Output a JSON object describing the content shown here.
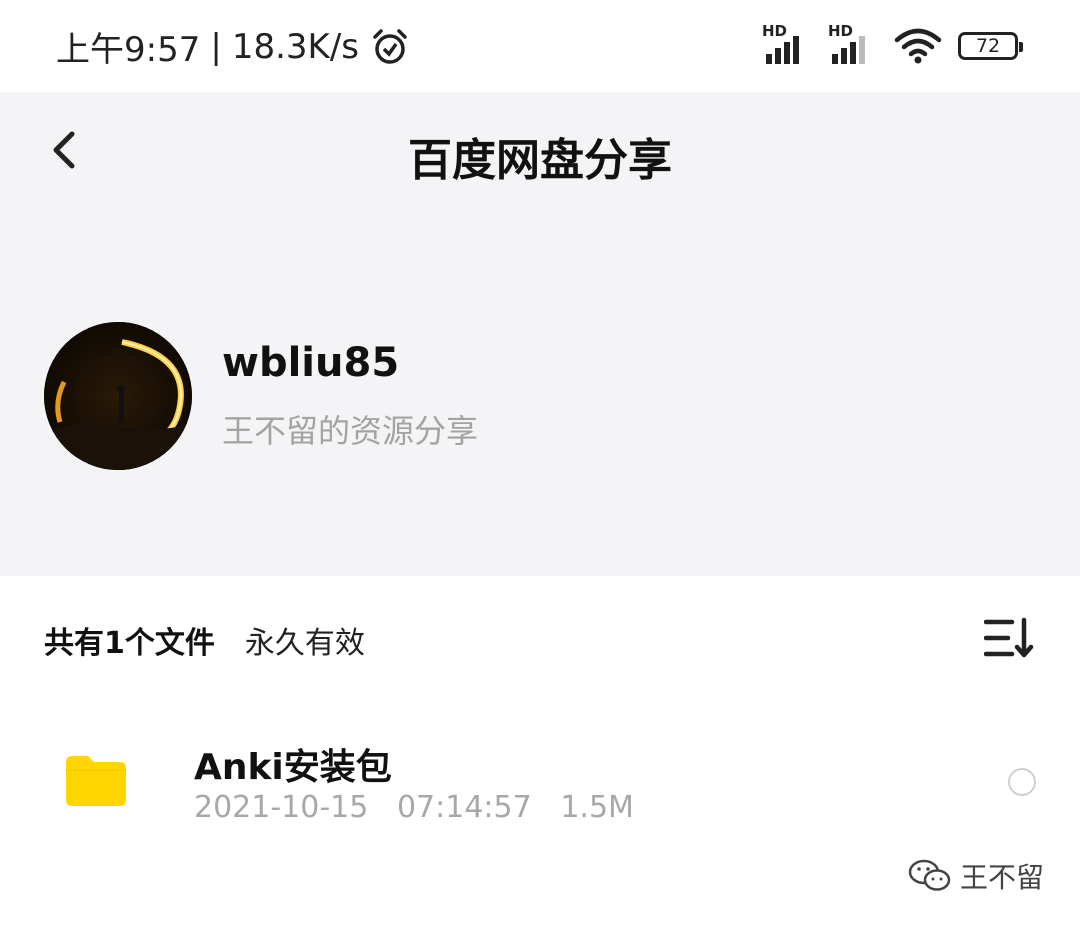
{
  "status_bar": {
    "time": "上午9:57",
    "separator": "|",
    "speed": "18.3K/s",
    "battery": "72",
    "signal_label_1": "HD",
    "signal_label_2": "HD",
    "icons": [
      "alarm-icon",
      "signal-icon",
      "wifi-icon",
      "battery-icon"
    ]
  },
  "header": {
    "title": "百度网盘分享",
    "back_icon": "chevron-left-icon"
  },
  "profile": {
    "username": "wbliu85",
    "description": "王不留的资源分享"
  },
  "files_header": {
    "count_label": "共有1个文件",
    "validity": "永久有效",
    "sort_icon": "sort-icon"
  },
  "files": [
    {
      "name": "Anki安装包",
      "date": "2021-10-15",
      "time": "07:14:57",
      "size": "1.5M",
      "icon": "folder-icon"
    }
  ],
  "watermark": {
    "text": "王不留",
    "icon": "wechat-icon"
  },
  "colors": {
    "folder": "#ffd600",
    "page_background": "#f4f4f6",
    "panel_background": "#ffffff",
    "secondary_text": "#a3a3a3"
  }
}
